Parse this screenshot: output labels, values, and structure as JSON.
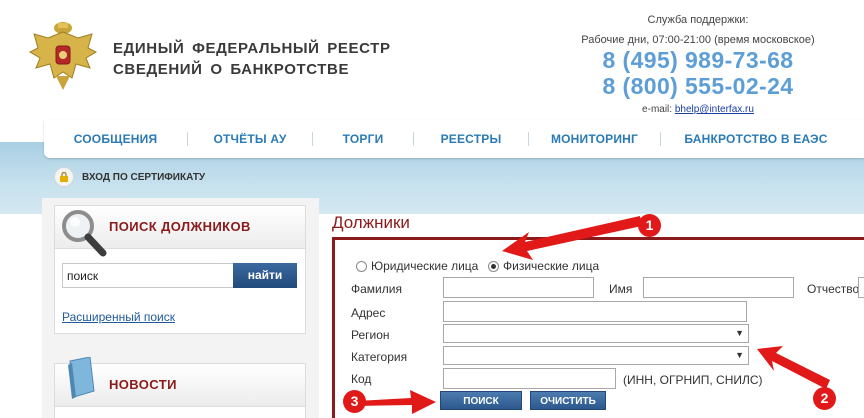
{
  "header": {
    "title_line1": "ЕДИНЫЙ ФЕДЕРАЛЬНЫЙ РЕЕСТР",
    "title_line2": "СВЕДЕНИЙ О БАНКРОТСТВЕ",
    "support_label": "Служба поддержки:",
    "hours": "Рабочие дни, 07:00-21:00 (время московское)",
    "phone1": "8 (495) 989-73-68",
    "phone2": "8 (800) 555-02-24",
    "email_prefix": "e-mail:",
    "email": "bhelp@interfax.ru"
  },
  "nav": {
    "items": [
      "СООБЩЕНИЯ",
      "ОТЧЁТЫ АУ",
      "ТОРГИ",
      "РЕЕСТРЫ",
      "МОНИТОРИНГ",
      "БАНКРОТСТВО В ЕАЭС"
    ]
  },
  "cert_login": "ВХОД ПО СЕРТИФИКАТУ",
  "sidebar": {
    "search_title": "ПОИСК ДОЛЖНИКОВ",
    "search_value": "поиск",
    "search_button": "найти",
    "advanced_link": "Расширенный поиск",
    "news_title": "НОВОСТИ"
  },
  "main": {
    "title": "Должники",
    "radio_legal": "Юридические лица",
    "radio_physical": "Физические лица",
    "selected_radio": "physical",
    "surname_label": "Фамилия",
    "name_label": "Имя",
    "patronymic_label": "Отчество",
    "address_label": "Адрес",
    "region_label": "Регион",
    "category_label": "Категория",
    "code_label": "Код",
    "code_hint": "(ИНН, ОГРНИП, СНИЛС)",
    "search_button": "ПОИСК",
    "clear_button": "ОЧИСТИТЬ"
  },
  "annotations": {
    "colors": {
      "arrow": "#e11919"
    },
    "badges": [
      "1",
      "2",
      "3"
    ]
  }
}
